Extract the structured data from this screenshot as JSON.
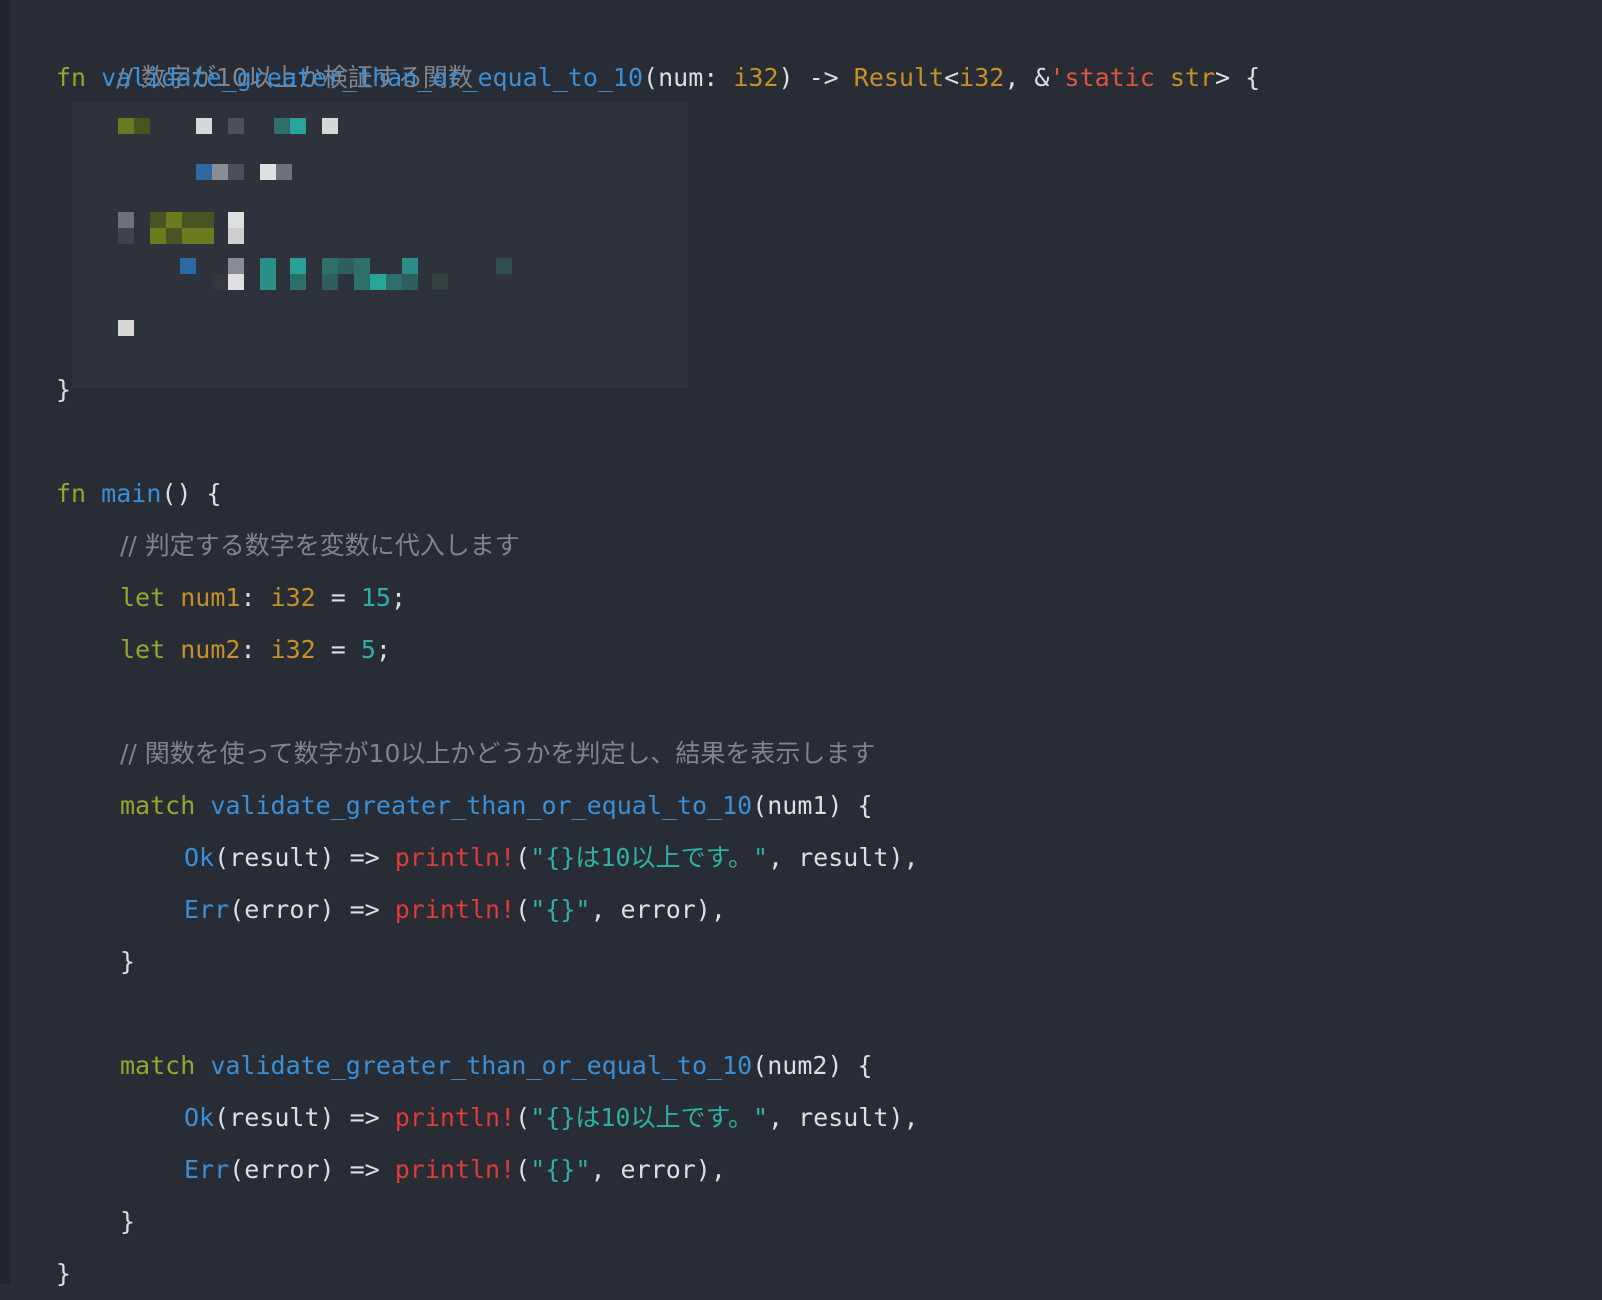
{
  "code": {
    "l1_comment": "// 数字が10以上か検証する関数",
    "l2": {
      "kw_fn": "fn",
      "fn_name": "validate_greater_than_or_equal_to_10",
      "open": "(",
      "param": "num",
      "colon": ": ",
      "type_i32": "i32",
      "arrow": ") -> ",
      "result_type": "Result",
      "lt": "<",
      "type_i32_2": "i32",
      "comma_amp": ", &",
      "lifetime": "'static",
      "space": " ",
      "str_type": "str",
      "gt_brace": "> {"
    },
    "close_brace_1": "}",
    "main_kw": "fn",
    "main_name": "main",
    "main_rest": "() {",
    "c2_comment": "// 判定する数字を変数に代入します",
    "let1": {
      "kw": "let",
      "name": "num1",
      "colon": ": ",
      "type": "i32",
      "eq": " = ",
      "value": "15",
      "semi": ";"
    },
    "let2": {
      "kw": "let",
      "name": "num2",
      "colon": ": ",
      "type": "i32",
      "eq": " = ",
      "value": "5",
      "semi": ";"
    },
    "c3_comment": "// 関数を使って数字が10以上かどうかを判定し、結果を表示します",
    "match1": {
      "kw": "match",
      "fn": "validate_greater_than_or_equal_to_10",
      "args": "(num1) {"
    },
    "match2": {
      "kw": "match",
      "fn": "validate_greater_than_or_equal_to_10",
      "args": "(num2) {"
    },
    "ok_arm": {
      "variant": "Ok",
      "bind": "(result) => ",
      "macro": "println!",
      "open": "(",
      "str": "\"{}は10以上です。\"",
      "rest": ", result),"
    },
    "err_arm": {
      "variant": "Err",
      "bind": "(error) => ",
      "macro": "println!",
      "open": "(",
      "str": "\"{}\"",
      "rest": ", error),"
    },
    "inner_close": "}",
    "final_close": "}"
  },
  "colors": {
    "background": "#282c34",
    "keyword": "#98a62f",
    "function": "#3b8fd6",
    "type": "#c69026",
    "number_string": "#2fb0a4",
    "macro": "#e03a3a",
    "comment": "#7f848e"
  }
}
